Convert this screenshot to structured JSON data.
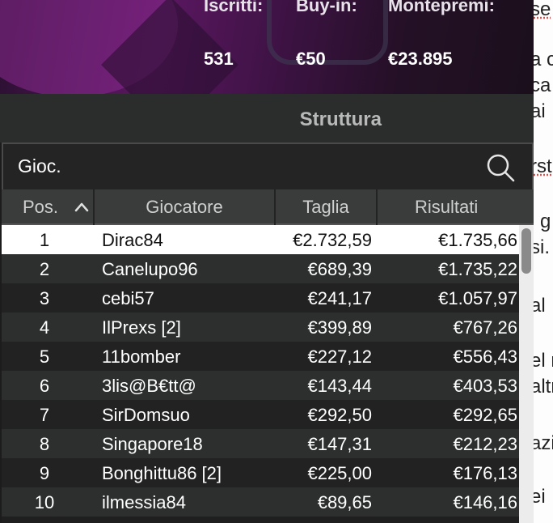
{
  "banner": {
    "stats": [
      {
        "label": "Iscritti:",
        "value": "531"
      },
      {
        "label": "Buy-in:",
        "value": "€50"
      },
      {
        "label": "Montepremi:",
        "value": "€23.895"
      }
    ]
  },
  "section": {
    "title": "Struttura"
  },
  "filter": {
    "label": "Gioc."
  },
  "table": {
    "headers": {
      "pos": "Pos.",
      "player": "Giocatore",
      "size": "Taglia",
      "result": "Risultati"
    },
    "rows": [
      {
        "pos": "1",
        "player": "Dirac84",
        "size": "€2.732,59",
        "result": "€1.735,66"
      },
      {
        "pos": "2",
        "player": "Canelupo96",
        "size": "€689,39",
        "result": "€1.735,22"
      },
      {
        "pos": "3",
        "player": "cebi57",
        "size": "€241,17",
        "result": "€1.057,97"
      },
      {
        "pos": "4",
        "player": "IlPrexs [2]",
        "size": "€399,89",
        "result": "€767,26"
      },
      {
        "pos": "5",
        "player": "11bomber",
        "size": "€227,12",
        "result": "€556,43"
      },
      {
        "pos": "6",
        "player": "3lis@B€tt@",
        "size": "€143,44",
        "result": "€403,53"
      },
      {
        "pos": "7",
        "player": "SirDomsuo",
        "size": "€292,50",
        "result": "€292,65"
      },
      {
        "pos": "8",
        "player": "Singapore18",
        "size": "€147,31",
        "result": "€212,23"
      },
      {
        "pos": "9",
        "player": "Bonghittu86 [2]",
        "size": "€225,00",
        "result": "€176,13"
      },
      {
        "pos": "10",
        "player": "ilmessia84",
        "size": "€89,65",
        "result": "€146,16"
      }
    ]
  },
  "background_doc": {
    "fragments": [
      "se",
      "a c",
      "ca",
      "ai",
      "rst",
      "i g",
      "si.",
      "al",
      "el n",
      "altr",
      "azi",
      "ei"
    ]
  }
}
